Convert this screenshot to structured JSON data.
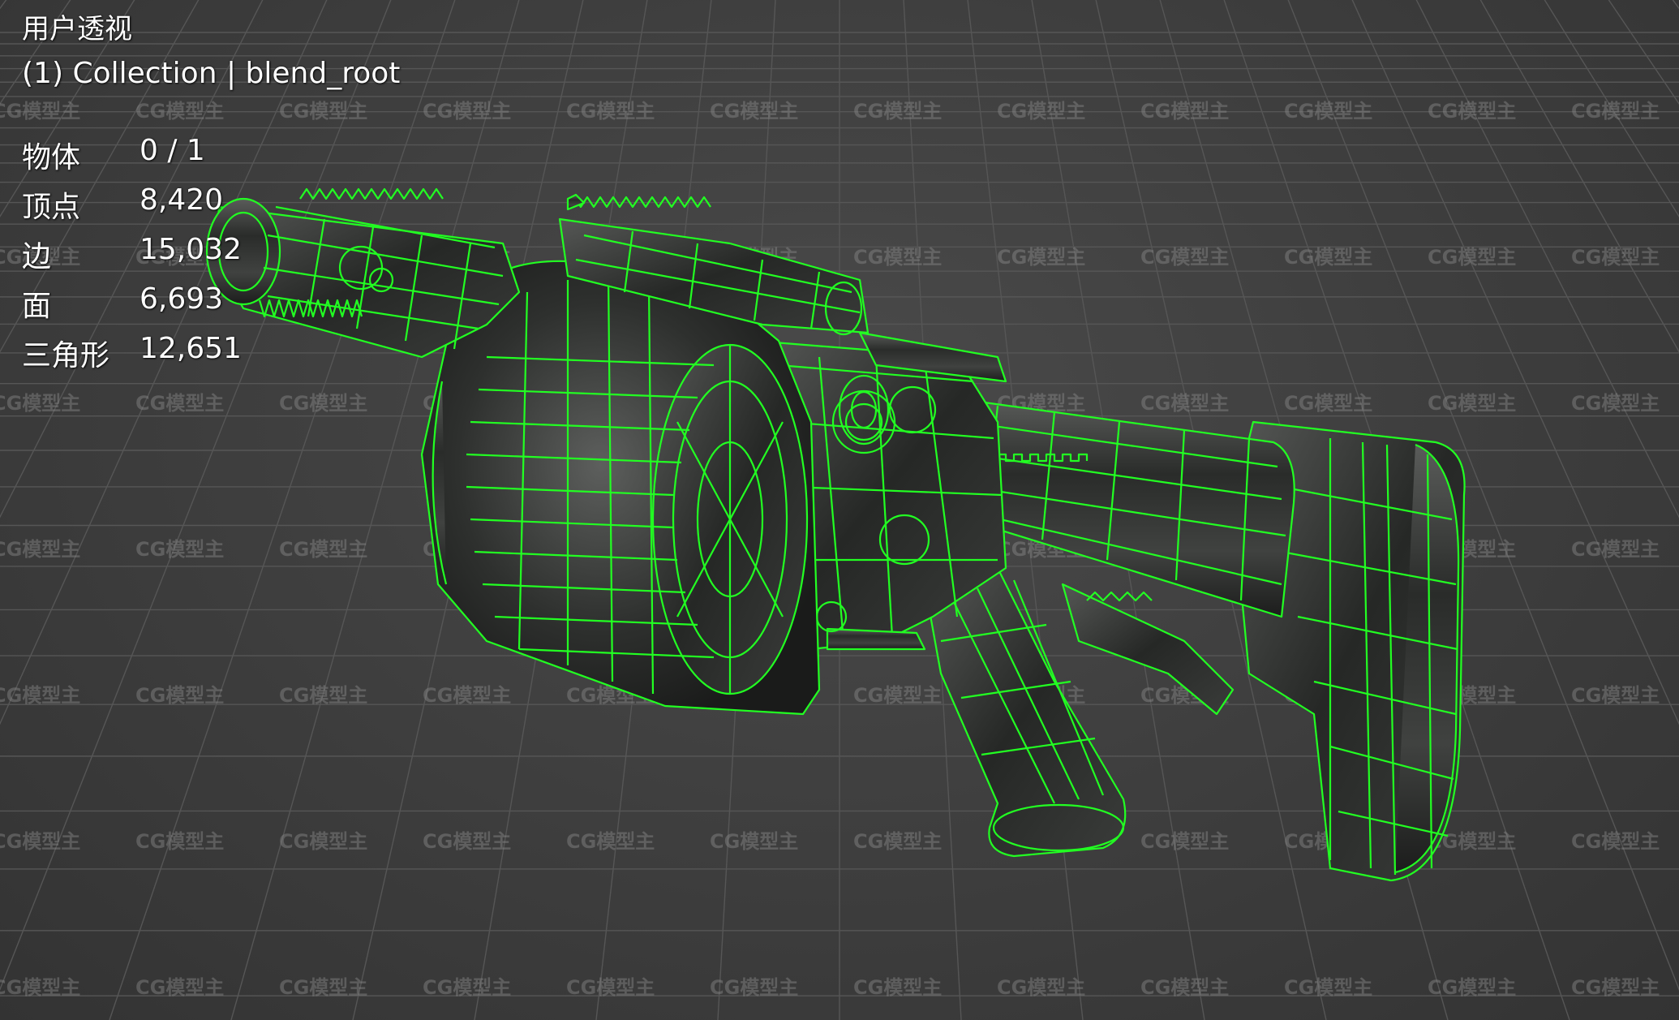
{
  "viewport": {
    "view_name": "用户透视",
    "collection_label": "(1) Collection | blend_root",
    "background_color": "#3d3d3d",
    "grid_color": "#565656",
    "wire_color": "#22ff22"
  },
  "stats": [
    {
      "label": "物体",
      "value": "0 / 1"
    },
    {
      "label": "顶点",
      "value": "8,420"
    },
    {
      "label": "边",
      "value": "15,032"
    },
    {
      "label": "面",
      "value": "6,693"
    },
    {
      "label": "三角形",
      "value": "12,651"
    }
  ],
  "watermark": {
    "text": "CG模型主"
  }
}
